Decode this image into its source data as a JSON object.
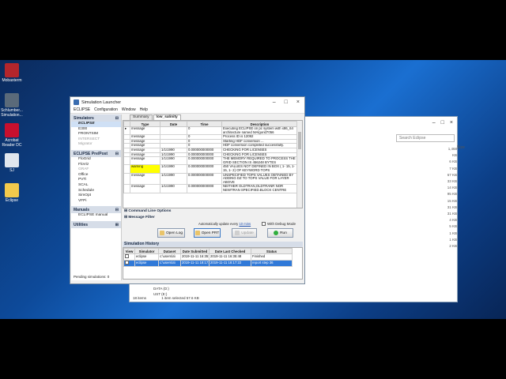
{
  "desktop_icons": [
    {
      "label": "Mobaxterm",
      "color": "#b3262c"
    },
    {
      "label": "Schlumber... Simulation...",
      "color": "#5a6a7a"
    },
    {
      "label": "Acrobat Reader DC",
      "color": "#c8102e"
    },
    {
      "label": "SJ",
      "color": "#e0e6ee"
    },
    {
      "label": "Eclipse",
      "color": "#f2c94c"
    }
  ],
  "explorer": {
    "search_placeholder": "Search Eclipse",
    "size_header": "Size",
    "sizes": [
      "1,468 KB",
      "6 KB",
      "7 KB",
      "67 KB",
      "33 KB",
      "14 KB",
      "95 KB",
      "15 KB",
      "31 KB",
      "31 KB",
      "4 KB",
      "5 KB",
      "1 KB",
      "1 KB",
      "2 KB"
    ],
    "status_items": "18 items",
    "status_selected": "1 item selected  57.6 KB",
    "nav_items": [
      "DATA (D:)",
      "UST (E:)"
    ]
  },
  "launcher": {
    "title": "Simulation Launcher",
    "menu": [
      "ECLIPSE",
      "Configuration",
      "Window",
      "Help"
    ],
    "sidebar": {
      "simulators_header": "Simulators",
      "simulators": [
        {
          "label": "ECLIPSE",
          "state": "sel"
        },
        {
          "label": "E300",
          "state": ""
        },
        {
          "label": "FRONTSIM",
          "state": ""
        },
        {
          "label": "INTERSECT",
          "state": "dis"
        },
        {
          "label": "Migrator",
          "state": "dis"
        }
      ],
      "prepost_header": "ECLIPSE Pre/Post",
      "prepost": [
        {
          "label": "FloGrid",
          "state": ""
        },
        {
          "label": "FloViz",
          "state": ""
        },
        {
          "label": "GRAF",
          "state": "dis"
        },
        {
          "label": "Office",
          "state": ""
        },
        {
          "label": "PVTi",
          "state": ""
        },
        {
          "label": "SCAL",
          "state": ""
        },
        {
          "label": "Schedule",
          "state": ""
        },
        {
          "label": "SimOpt",
          "state": ""
        },
        {
          "label": "VFPi",
          "state": ""
        }
      ],
      "manuals_header": "Manuals",
      "manuals": [
        {
          "label": "ECLIPSE manual",
          "state": ""
        }
      ],
      "utilities_header": "Utilities",
      "pending": "Pending simulations: 0"
    },
    "tabs": [
      "Summary",
      "low_salinity"
    ],
    "columns": [
      "Type",
      "Date",
      "Time",
      "Description"
    ],
    "messages": [
      {
        "type": "message",
        "date": "",
        "time": "0",
        "desc": "Executing ECLIPSE on pc system with x86_64 architecture named MAlgorid7056",
        "warn": false
      },
      {
        "type": "message",
        "date": "",
        "time": "0",
        "desc": "Process ID is 12092",
        "warn": false
      },
      {
        "type": "message",
        "date": "",
        "time": "0",
        "desc": "Starting HDF conversion ...",
        "warn": false
      },
      {
        "type": "message",
        "date": "",
        "time": "0",
        "desc": "HDF conversion completed successfully.",
        "warn": false
      },
      {
        "type": "message",
        "date": "1/1/1990",
        "time": "0.000000000000",
        "desc": "CHECKING FOR LICENSES",
        "warn": false
      },
      {
        "type": "message",
        "date": "1/1/1990",
        "time": "0.000000000000",
        "desc": "CHECKING FOR LICENSES",
        "warn": false
      },
      {
        "type": "message",
        "date": "1/1/1990",
        "time": "0.000000000000",
        "desc": "THE MEMORY REQUIRED TO PROCESS THE GRID SECTION IS 456248 BYTES",
        "warn": false
      },
      {
        "type": "warning",
        "date": "1/1/1990",
        "time": "0.000000000000",
        "desc": "450 VALUES NOT DEFINED IN BOX ( 1- 15, 1- 15, 1- 2) OF KEYWORD TOPS",
        "warn": true
      },
      {
        "type": "message",
        "date": "1/1/1990",
        "time": "0.000000000000",
        "desc": "UNSPECIFIED TOPS VALUES OBTAINED BY ADDING DZ TO TOPS VALUE FOR LAYER ABOVE",
        "warn": false
      },
      {
        "type": "message",
        "date": "1/1/1990",
        "time": "0.000000000000",
        "desc": "NEITHER OLDTRAN,OLDTRANR NOR NEWTRAN SPECIFIED.BLOCK CENTRE",
        "warn": false
      }
    ],
    "command_line_label": "Command Line Options",
    "message_filter_label": "Message Filter",
    "auto_update_text": "Automatically update every",
    "auto_update_link": "10 mins",
    "debug_label": "With Debug Mode",
    "buttons": {
      "open_log": "Open Log",
      "open_prt": "Open PRT",
      "update": "Update",
      "run": "Run"
    },
    "history_header": "Simulation History",
    "history_columns": [
      "View",
      "Simulator",
      "Dataset",
      "Date Submitted",
      "Date Last Checked",
      "Status"
    ],
    "history_rows": [
      {
        "simulator": "eclipse",
        "dataset": "c:\\users\\a\\",
        "submitted": "2019-11-11 16:35:",
        "checked": "2019-11-11 16:35:48",
        "status": "Finished",
        "selected": false
      },
      {
        "simulator": "eclipse",
        "dataset": "c:\\users\\a\\",
        "submitted": "2019-11-11 18:17:",
        "checked": "2019-11-11 18:17:22",
        "status": "report step 36",
        "selected": true
      }
    ]
  }
}
